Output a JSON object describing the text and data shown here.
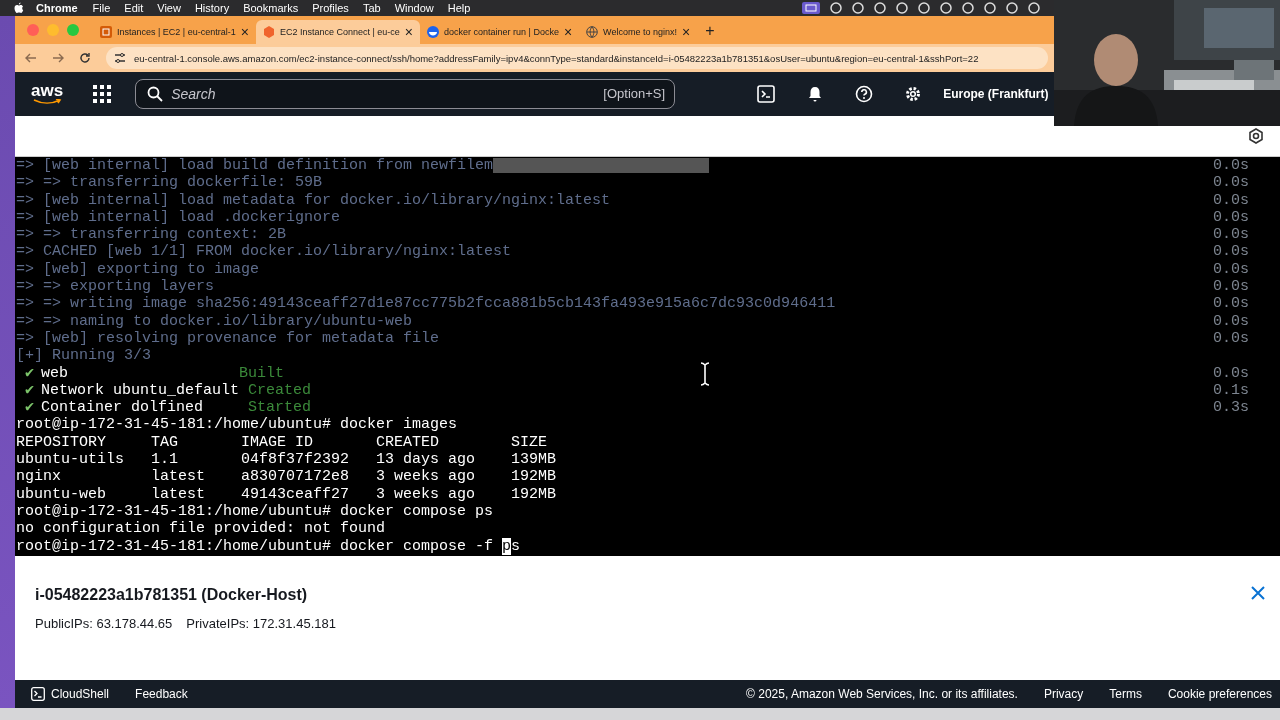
{
  "menu_bar": {
    "app": "Chrome",
    "items": [
      "File",
      "Edit",
      "View",
      "History",
      "Bookmarks",
      "Profiles",
      "Tab",
      "Window",
      "Help"
    ]
  },
  "tabs": [
    {
      "title": "Instances | EC2 | eu-central-1",
      "kind": "ec2",
      "close": "×",
      "selected": false
    },
    {
      "title": "EC2 Instance Connect | eu-ce",
      "kind": "connect",
      "close": "×",
      "selected": true
    },
    {
      "title": "docker container run | Docke",
      "kind": "docker",
      "close": "×",
      "selected": false
    },
    {
      "title": "Welcome to nginx!",
      "kind": "globe",
      "close": "×",
      "selected": false
    }
  ],
  "new_tab": "+",
  "address_bar": {
    "url": "eu-central-1.console.aws.amazon.com/ec2-instance-connect/ssh/home?addressFamily=ipv4&connType=standard&instanceId=i-05482223a1b781351&osUser=ubuntu&region=eu-central-1&sshPort=22"
  },
  "aws_nav": {
    "logo": "aws",
    "search": {
      "placeholder": "Search",
      "shortcut": "[Option+S]"
    },
    "region": "Europe (Frankfurt)"
  },
  "terminal": {
    "lines": [
      {
        "kind": "log",
        "text": "=> [web internal] load build definition from newfilem",
        "time": "0.0s",
        "highlight": true
      },
      {
        "kind": "log",
        "text": "=> => transferring dockerfile: 59B",
        "time": "0.0s"
      },
      {
        "kind": "log",
        "text": "=> [web internal] load metadata for docker.io/library/nginx:latest",
        "time": "0.0s"
      },
      {
        "kind": "log",
        "text": "=> [web internal] load .dockerignore",
        "time": "0.0s"
      },
      {
        "kind": "log",
        "text": "=> => transferring context: 2B",
        "time": "0.0s"
      },
      {
        "kind": "log",
        "text": "=> CACHED [web 1/1] FROM docker.io/library/nginx:latest",
        "time": "0.0s"
      },
      {
        "kind": "log",
        "text": "=> [web] exporting to image",
        "time": "0.0s"
      },
      {
        "kind": "log",
        "text": "=> => exporting layers",
        "time": "0.0s"
      },
      {
        "kind": "log",
        "text": "=> => writing image sha256:49143ceaff27d1e87cc775b2fcca881b5cb143fa493e915a6c7dc93c0d946411",
        "time": "0.0s"
      },
      {
        "kind": "log",
        "text": "=> => naming to docker.io/library/ubuntu-web",
        "time": "0.0s"
      },
      {
        "kind": "log",
        "text": "=> [web] resolving provenance for metadata file",
        "time": "0.0s"
      },
      {
        "kind": "log",
        "text": "[+] Running 3/3"
      },
      {
        "kind": "status",
        "mark": "✔",
        "text": "web                   ",
        "status": "Built",
        "time": "0.0s"
      },
      {
        "kind": "status",
        "mark": "✔",
        "text": "Network ubuntu_default ",
        "status": "Created",
        "time": "0.1s"
      },
      {
        "kind": "status",
        "mark": "✔",
        "text": "Container dolfined     ",
        "status": "Started",
        "time": "0.3s"
      },
      {
        "kind": "plain",
        "text": "root@ip-172-31-45-181:/home/ubuntu# docker images"
      },
      {
        "kind": "plain",
        "text": "REPOSITORY     TAG       IMAGE ID       CREATED        SIZE"
      },
      {
        "kind": "plain",
        "text": "ubuntu-utils   1.1       04f8f37f2392   13 days ago    139MB"
      },
      {
        "kind": "plain",
        "text": "nginx          latest    a830707172e8   3 weeks ago    192MB"
      },
      {
        "kind": "plain",
        "text": "ubuntu-web     latest    49143ceaff27   3 weeks ago    192MB"
      },
      {
        "kind": "plain",
        "text": "root@ip-172-31-45-181:/home/ubuntu# docker compose ps"
      },
      {
        "kind": "plain",
        "text": "no configuration file provided: not found"
      },
      {
        "kind": "prompt",
        "text": "root@ip-172-31-45-181:/home/ubuntu# docker compose -f ",
        "cursor": "p",
        "after": "s"
      }
    ]
  },
  "instance_panel": {
    "title": "i-05482223a1b781351 (Docker-Host)",
    "public_ips": "PublicIPs: 63.178.44.65",
    "private_ips": "PrivateIPs: 172.31.45.181"
  },
  "footer": {
    "cloudshell": "CloudShell",
    "feedback": "Feedback",
    "copyright": "© 2025, Amazon Web Services, Inc. or its affiliates.",
    "links": [
      "Privacy",
      "Terms",
      "Cookie preferences"
    ]
  }
}
